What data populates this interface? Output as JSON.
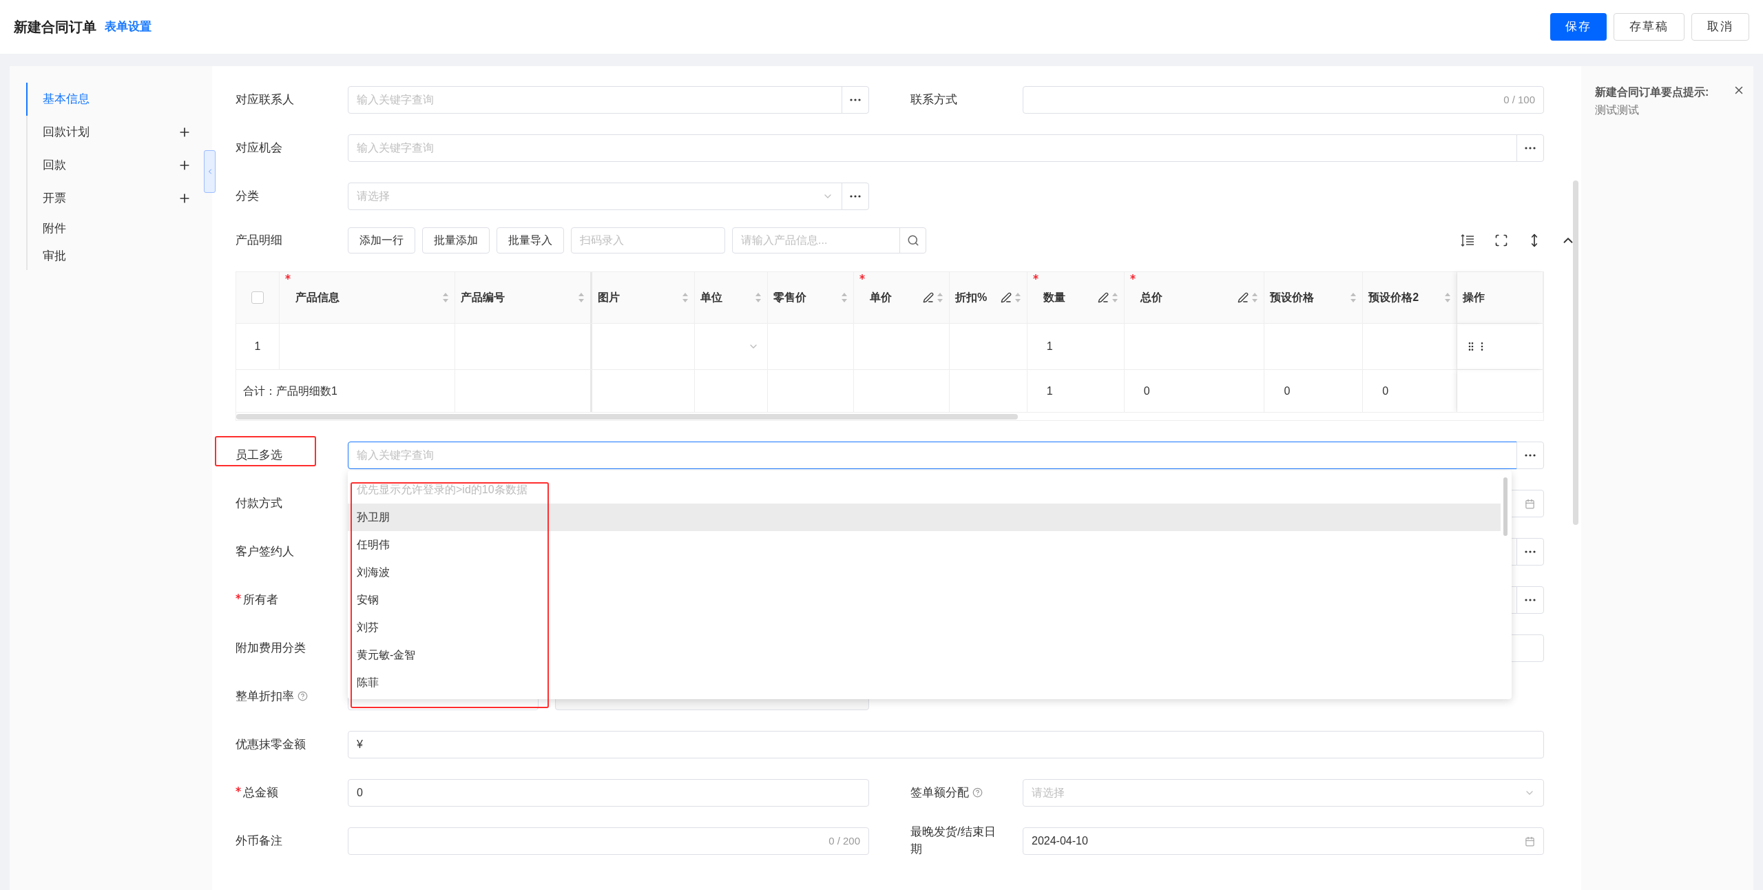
{
  "header": {
    "title": "新建合同订单",
    "link": "表单设置",
    "buttons": [
      {
        "label": "保存",
        "kind": "primary"
      },
      {
        "label": "存草稿",
        "kind": "default"
      },
      {
        "label": "取消",
        "kind": "default"
      }
    ]
  },
  "nav": {
    "items": [
      {
        "label": "基本信息",
        "selected": true,
        "addable": false
      },
      {
        "label": "回款计划",
        "selected": false,
        "addable": true
      },
      {
        "label": "回款",
        "selected": false,
        "addable": true
      },
      {
        "label": "开票",
        "selected": false,
        "addable": true
      },
      {
        "label": "附件",
        "selected": false,
        "addable": false
      },
      {
        "label": "审批",
        "selected": false,
        "addable": false
      }
    ]
  },
  "form_top": [
    {
      "kind": "pair",
      "annotated": false,
      "left": {
        "label": "对应联系人",
        "kind": "lookup",
        "placeholder": "输入关键字查询",
        "required": false,
        "help": false
      },
      "right": {
        "label": "联系方式",
        "kind": "counter",
        "counter": "0 / 100",
        "required": false,
        "help": false
      }
    },
    {
      "kind": "full",
      "annotated": false,
      "field": {
        "label": "对应机会",
        "kind": "lookup",
        "placeholder": "输入关键字查询",
        "required": false,
        "help": false
      }
    },
    {
      "kind": "half",
      "annotated": false,
      "field": {
        "label": "分类",
        "kind": "select_lookup",
        "placeholder": "请选择",
        "required": false,
        "help": false
      }
    }
  ],
  "products": {
    "label": "产品明细",
    "buttons": [
      "添加一行",
      "批量添加",
      "批量导入"
    ],
    "scan_placeholder": "扫码录入",
    "search_placeholder": "请输入产品信息...",
    "select_all_checked": false,
    "row_index": "1",
    "total_label": "合计：产品明细数1",
    "columns": [
      {
        "label": "产品信息",
        "kind": "text",
        "required": true,
        "editable": false,
        "sortable": true
      },
      {
        "label": "产品编号",
        "kind": "text",
        "required": false,
        "editable": false,
        "sortable": true
      },
      {
        "label": "图片",
        "kind": "text",
        "required": false,
        "editable": false,
        "sortable": true
      },
      {
        "label": "单位",
        "kind": "select",
        "required": false,
        "editable": false,
        "sortable": true
      },
      {
        "label": "零售价",
        "kind": "text",
        "required": false,
        "editable": false,
        "sortable": true
      },
      {
        "label": "单价",
        "kind": "text",
        "required": true,
        "editable": true,
        "sortable": true
      },
      {
        "label": "折扣%",
        "kind": "text",
        "required": false,
        "editable": true,
        "sortable": true
      },
      {
        "label": "数量",
        "kind": "text",
        "required": true,
        "editable": true,
        "sortable": true,
        "row_value": "1",
        "total": "1"
      },
      {
        "label": "总价",
        "kind": "text",
        "required": true,
        "editable": true,
        "sortable": true,
        "total": "0"
      },
      {
        "label": "预设价格",
        "kind": "text",
        "required": false,
        "editable": false,
        "sortable": true,
        "total": "0"
      },
      {
        "label": "预设价格2",
        "kind": "text",
        "required": false,
        "editable": false,
        "sortable": true,
        "total": "0"
      },
      {
        "label": "操作",
        "kind": "actions",
        "required": false,
        "editable": false,
        "sortable": false
      }
    ]
  },
  "form_bottom": [
    {
      "kind": "full",
      "annotated": true,
      "field": {
        "label": "员工多选",
        "kind": "lookup",
        "placeholder": "输入关键字查询",
        "required": false,
        "help": false,
        "focused": true,
        "dropdown": {
          "hint": "优先显示允许登录的>id的10条数据",
          "annotated": true,
          "options": [
            {
              "label": "孙卫朋",
              "selected": true
            },
            {
              "label": "任明伟",
              "selected": false
            },
            {
              "label": "刘海波",
              "selected": false
            },
            {
              "label": "安钢",
              "selected": false
            },
            {
              "label": "刘芬",
              "selected": false
            },
            {
              "label": "黄元敏-金智",
              "selected": false
            },
            {
              "label": "陈菲",
              "selected": false
            }
          ]
        }
      }
    },
    {
      "kind": "full",
      "annotated": false,
      "field": {
        "label": "付款方式",
        "kind": "date",
        "required": false,
        "help": false
      }
    },
    {
      "kind": "full",
      "annotated": false,
      "field": {
        "label": "客户签约人",
        "kind": "lookup",
        "required": false,
        "help": false
      }
    },
    {
      "kind": "full",
      "annotated": false,
      "field": {
        "label": "所有者",
        "kind": "lookup",
        "required": true,
        "help": false
      }
    },
    {
      "kind": "full",
      "annotated": false,
      "field": {
        "label": "附加费用分类",
        "kind": "text",
        "required": false,
        "help": false
      }
    },
    {
      "kind": "half",
      "annotated": false,
      "field": {
        "label": "整单折扣率",
        "kind": "discount",
        "required": false,
        "help": true
      }
    },
    {
      "kind": "full",
      "annotated": false,
      "field": {
        "label": "优惠抹零金额",
        "kind": "money",
        "prefix": "¥",
        "required": false,
        "help": false
      }
    },
    {
      "kind": "pair",
      "annotated": false,
      "left": {
        "label": "总金额",
        "kind": "text",
        "value": "0",
        "required": true,
        "help": false
      },
      "right": {
        "label": "签单额分配",
        "kind": "select",
        "placeholder": "请选择",
        "required": false,
        "help": true
      }
    },
    {
      "kind": "pair",
      "annotated": false,
      "left": {
        "label": "外币备注",
        "kind": "counter",
        "counter": "0 / 200",
        "required": false,
        "help": false
      },
      "right": {
        "label": "最晚发货/结束日期",
        "kind": "date",
        "value": "2024-04-10",
        "required": false,
        "help": false
      }
    }
  ],
  "tip": {
    "title": "新建合同订单要点提示:",
    "text": "测试测试"
  }
}
